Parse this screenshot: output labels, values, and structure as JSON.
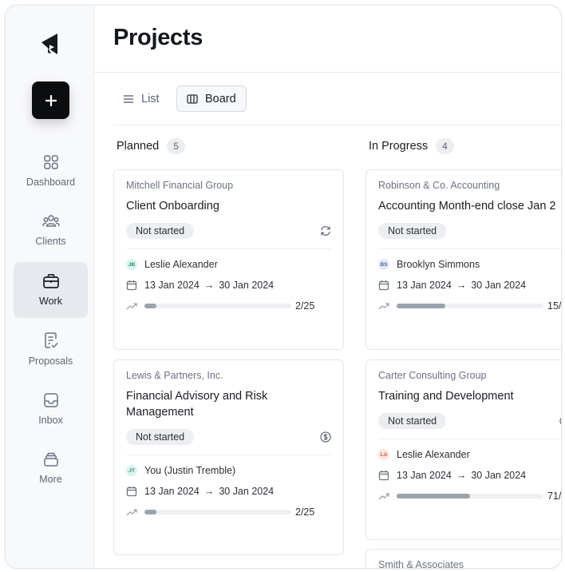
{
  "page": {
    "title": "Projects"
  },
  "sidebar": {
    "new_button_icon": "plus-icon",
    "items": [
      {
        "label": "Dashboard",
        "icon": "grid-icon",
        "active": false
      },
      {
        "label": "Clients",
        "icon": "users-icon",
        "active": false
      },
      {
        "label": "Work",
        "icon": "briefcase-icon",
        "active": true
      },
      {
        "label": "Proposals",
        "icon": "document-check-icon",
        "active": false
      },
      {
        "label": "Inbox",
        "icon": "inbox-icon",
        "active": false
      },
      {
        "label": "More",
        "icon": "stack-icon",
        "active": false
      }
    ]
  },
  "toolbar": {
    "list_label": "List",
    "board_label": "Board",
    "active_view": "Board"
  },
  "columns": [
    {
      "title": "Planned",
      "count": "5",
      "cards": [
        {
          "client": "Mitchell Financial Group",
          "name": "Client Onboarding",
          "status": "Not started",
          "status_icon": "refresh-icon",
          "assignee": "Leslie Alexander",
          "initials": "JB",
          "avatar_color": "#d9f5ee",
          "avatar_text_color": "#2a8c72",
          "start": "13 Jan 2024",
          "end": "30 Jan 2024",
          "progress_text": "2/25",
          "progress": 0.08
        },
        {
          "client": "Lewis & Partners, Inc.",
          "name": "Financial Advisory and Risk Management",
          "status": "Not started",
          "status_icon": "dollar-icon",
          "assignee": "You (Justin Tremble)",
          "initials": "JT",
          "avatar_color": "#d9f5ee",
          "avatar_text_color": "#2a8c72",
          "start": "13 Jan 2024",
          "end": "30 Jan 2024",
          "progress_text": "2/25",
          "progress": 0.08
        }
      ]
    },
    {
      "title": "In Progress",
      "count": "4",
      "cards": [
        {
          "client": "Robinson & Co. Accounting",
          "name": "Accounting Month-end close Jan 2",
          "status": "Not started",
          "status_icon": "",
          "assignee": "Brooklyn Simmons",
          "initials": "BS",
          "avatar_color": "#e6e9f7",
          "avatar_text_color": "#5660a8",
          "start": "13 Jan 2024",
          "end": "30 Jan 2024",
          "progress_text": "15/",
          "progress": 0.33
        },
        {
          "client": "Carter Consulting Group",
          "name": "Training and Development",
          "status": "Not started",
          "status_icon": "dollar-icon",
          "assignee": "Leslie Alexander",
          "initials": "LA",
          "avatar_color": "#fde6dc",
          "avatar_text_color": "#c0603a",
          "start": "13 Jan 2024",
          "end": "30 Jan 2024",
          "progress_text": "71/",
          "progress": 0.5
        },
        {
          "client": "Smith & Associates"
        }
      ]
    }
  ]
}
